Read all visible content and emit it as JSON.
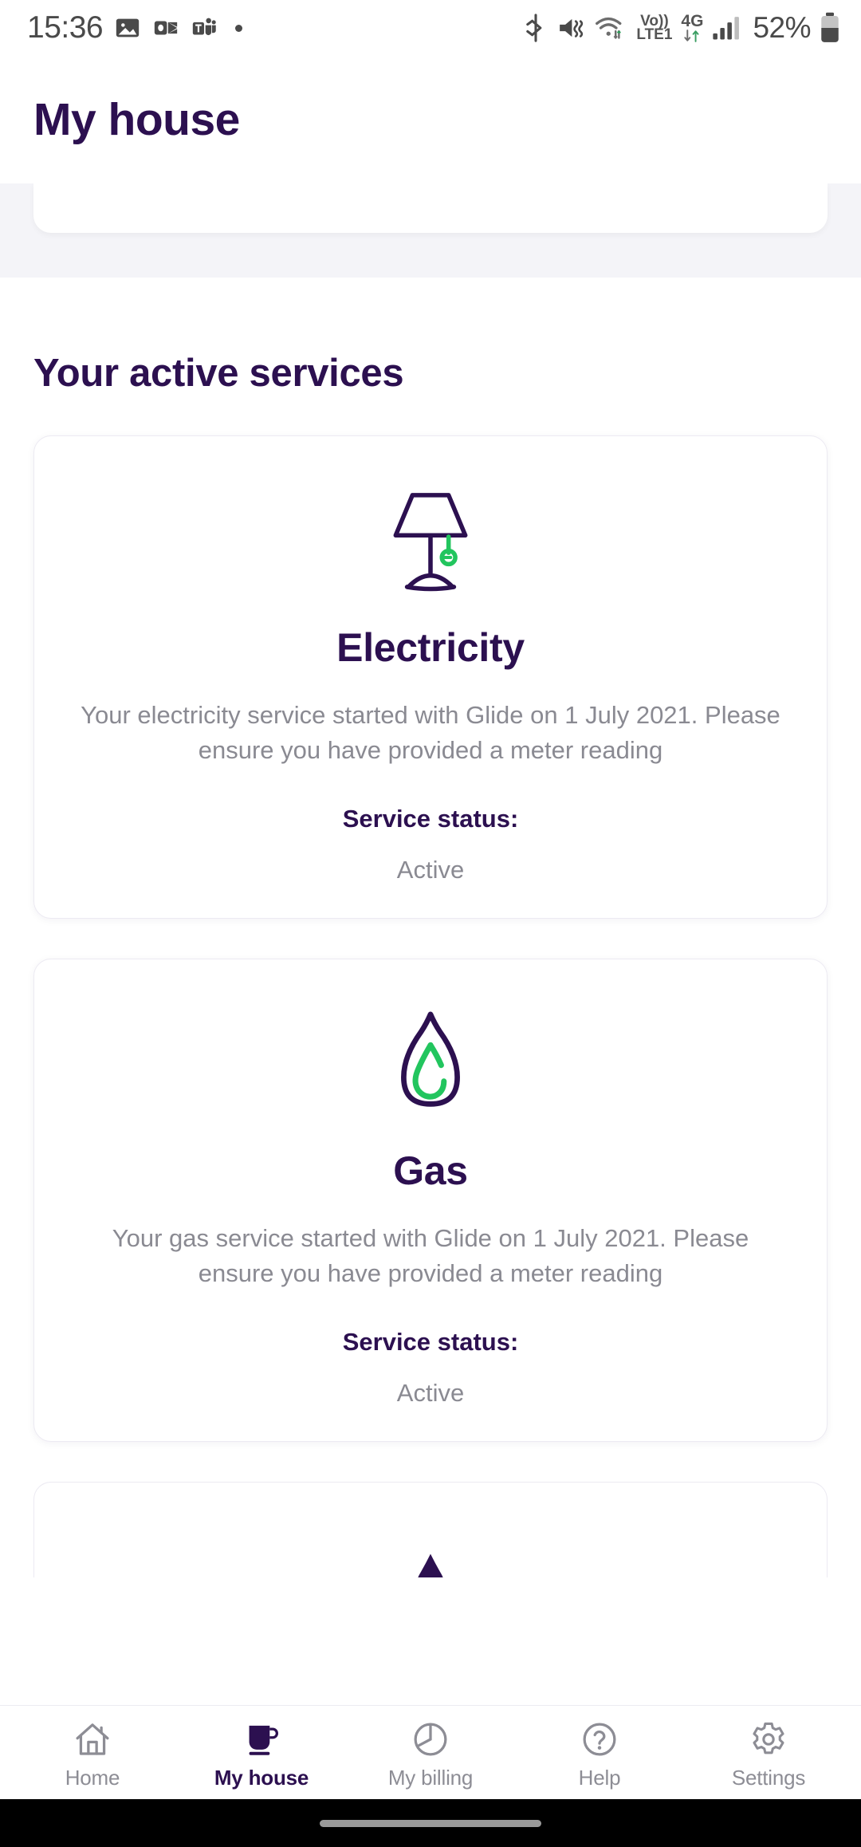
{
  "status_bar": {
    "time": "15:36",
    "battery_percent": "52%",
    "volte_top": "Vo))",
    "volte_bottom": "LTE1",
    "network_type": "4G",
    "icons": [
      "photos-icon",
      "outlook-icon",
      "teams-icon",
      "notification-dot-icon",
      "bluetooth-icon",
      "vibrate-mute-icon",
      "wifi-icon",
      "volte-icon",
      "mobile-data-icon",
      "signal-bars-icon",
      "battery-icon"
    ]
  },
  "header": {
    "title": "My house"
  },
  "main": {
    "section_title": "Your active services",
    "cards": [
      {
        "icon": "lamp-icon",
        "title": "Electricity",
        "description": "Your electricity service started with Glide on 1 July 2021. Please ensure you have provided a meter reading",
        "status_label": "Service status:",
        "status_value": "Active"
      },
      {
        "icon": "water-drop-flame-icon",
        "title": "Gas",
        "description": "Your gas service started with Glide on 1 July 2021. Please ensure you have provided a meter reading",
        "status_label": "Service status:",
        "status_value": "Active"
      }
    ]
  },
  "bottom_nav": {
    "items": [
      {
        "label": "Home",
        "icon": "house-icon",
        "active": false
      },
      {
        "label": "My house",
        "icon": "mug-icon",
        "active": true
      },
      {
        "label": "My billing",
        "icon": "pie-chart-icon",
        "active": false
      },
      {
        "label": "Help",
        "icon": "question-mark-icon",
        "active": false
      },
      {
        "label": "Settings",
        "icon": "gear-icon",
        "active": false
      }
    ]
  },
  "colors": {
    "brand_purple": "#2c1050",
    "accent_green": "#22c55e",
    "muted_text": "#8a8a92",
    "page_band": "#f4f4f8"
  }
}
